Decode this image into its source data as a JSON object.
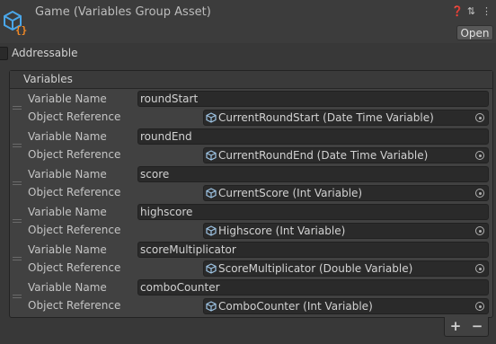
{
  "header": {
    "title": "Game (Variables Group Asset)",
    "open_label": "Open",
    "icons": [
      "help-icon",
      "preset-icon",
      "more-icon"
    ]
  },
  "addressable": {
    "label": "Addressable",
    "checked": false
  },
  "panel": {
    "title": "Variables"
  },
  "labels": {
    "variable_name": "Variable Name",
    "object_reference": "Object Reference"
  },
  "items": [
    {
      "name": "roundStart",
      "reference": "CurrentRoundStart (Date Time Variable)"
    },
    {
      "name": "roundEnd",
      "reference": "CurrentRoundEnd (Date Time Variable)"
    },
    {
      "name": "score",
      "reference": "CurrentScore (Int Variable)"
    },
    {
      "name": "highscore",
      "reference": "Highscore (Int Variable)"
    },
    {
      "name": "scoreMultiplicator",
      "reference": "ScoreMultiplicator (Double Variable)"
    },
    {
      "name": "comboCounter",
      "reference": "ComboCounter (Int Variable)"
    }
  ],
  "footer": {
    "add_label": "+",
    "remove_label": "−"
  },
  "colors": {
    "background": "#383838",
    "field": "#2a2a2a",
    "icon_blue": "#4aa6e8",
    "icon_orange": "#f58b26"
  }
}
